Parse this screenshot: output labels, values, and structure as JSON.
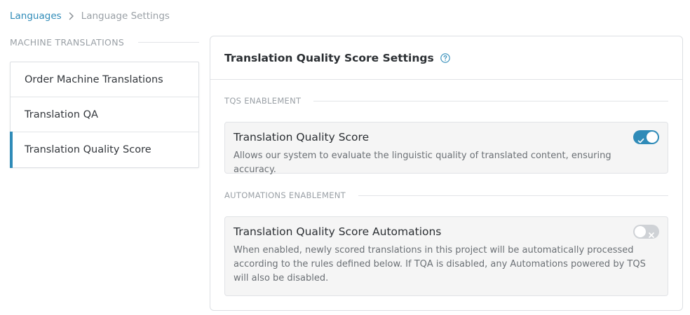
{
  "breadcrumb": {
    "parent": "Languages",
    "current": "Language Settings"
  },
  "sidebar": {
    "header": "MACHINE TRANSLATIONS",
    "items": [
      {
        "label": "Order Machine Translations",
        "active": false
      },
      {
        "label": "Translation QA",
        "active": false
      },
      {
        "label": "Translation Quality Score",
        "active": true
      }
    ]
  },
  "panel": {
    "title": "Translation Quality Score Settings",
    "help_icon": "question-circle-icon",
    "sections": [
      {
        "label": "TQS ENABLEMENT",
        "setting": {
          "title": "Translation Quality Score",
          "description": "Allows our system to evaluate the linguistic quality of translated content, ensuring accuracy.",
          "enabled": true
        }
      },
      {
        "label": "AUTOMATIONS ENABLEMENT",
        "setting": {
          "title": "Translation Quality Score Automations",
          "description": "When enabled, newly scored translations in this project will be automatically processed according to the rules defined below. If TQA is disabled, any Automations powered by TQS will also be disabled.",
          "enabled": false
        }
      }
    ]
  },
  "colors": {
    "accent": "#2f8bb8",
    "toggle_off": "#cfd2d6",
    "muted_text": "#9aa0a6"
  }
}
